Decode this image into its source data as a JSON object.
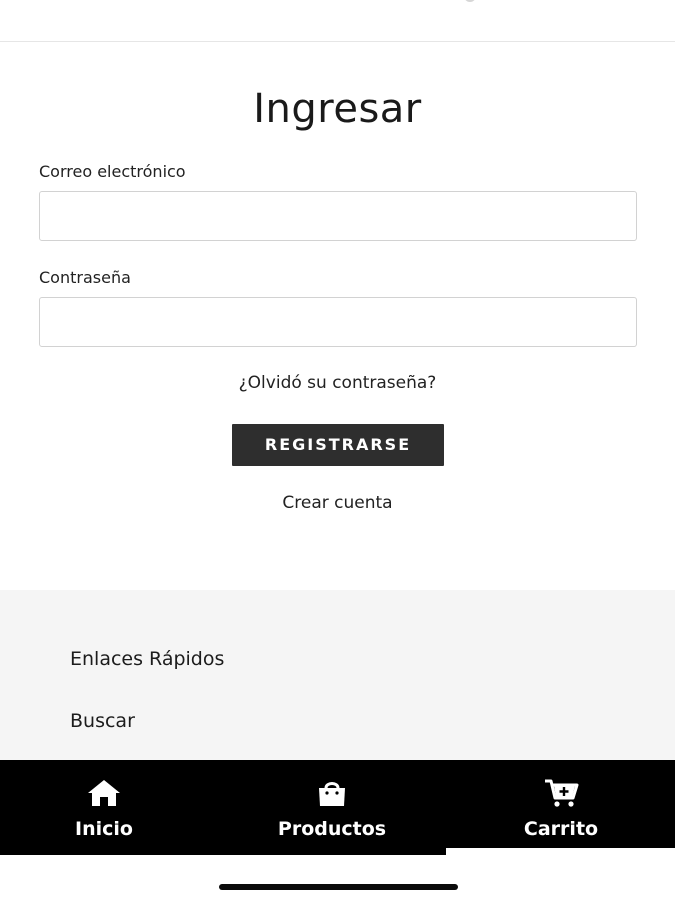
{
  "login": {
    "title": "Ingresar",
    "email_label": "Correo electrónico",
    "email_value": "",
    "password_label": "Contraseña",
    "password_value": "",
    "forgot_link": "¿Olvidó su contraseña?",
    "submit_label": "REGISTRARSE",
    "create_account_link": "Crear cuenta"
  },
  "footer": {
    "quick_links_title": "Enlaces Rápidos",
    "search_link": "Buscar"
  },
  "tab_bar": {
    "items": [
      {
        "label": "Inicio",
        "icon": "home-icon"
      },
      {
        "label": "Productos",
        "icon": "shopping-bag-icon"
      },
      {
        "label": "Carrito",
        "icon": "cart-plus-icon"
      }
    ]
  },
  "colors": {
    "button_bg": "#2e2e2e",
    "tab_bar_bg": "#000000",
    "footer_bg": "#f5f5f5"
  }
}
